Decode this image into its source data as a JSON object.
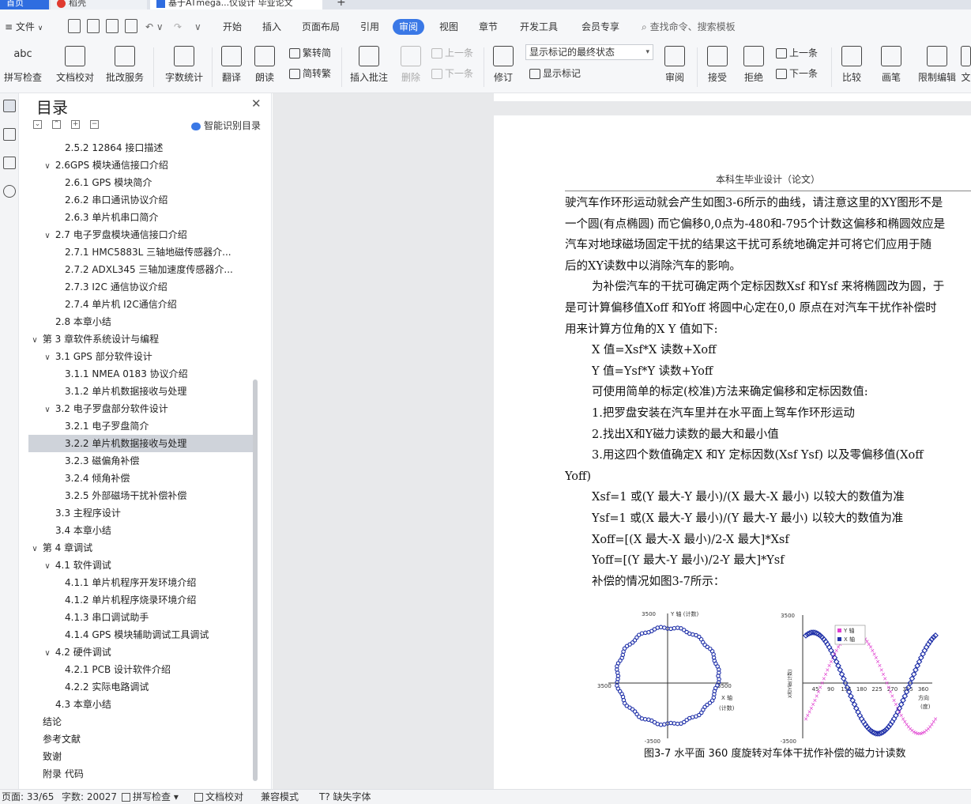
{
  "tabs": {
    "home": "首页",
    "find": "稻壳",
    "doc": "基于ATmega...仪设计 毕业论文",
    "new": "+"
  },
  "menu": {
    "file": "文件",
    "items": [
      "开始",
      "插入",
      "页面布局",
      "引用",
      "审阅",
      "视图",
      "章节",
      "开发工具",
      "会员专享"
    ],
    "active": "审阅",
    "search_placeholder": "查找命令、搜索模板"
  },
  "ribbon": {
    "spell_check": "拼写检查",
    "doc_proof": "文档校对",
    "batch_service": "批改服务",
    "word_count": "字数统计",
    "translate": "翻译",
    "read_aloud": "朗读",
    "trad_to_simp": "繁转简",
    "simp_to_trad": "简转繁",
    "insert_comment": "插入批注",
    "delete": "删除",
    "prev_item": "上一条",
    "next_item": "下一条",
    "revision": "修订",
    "markup_select": "显示标记的最终状态",
    "show_markup": "显示标记",
    "review": "审阅",
    "accept": "接受",
    "reject": "拒绝",
    "prev_change": "上一条",
    "next_change": "下一条",
    "compare": "比较",
    "pen": "画笔",
    "restrict_edit": "限制编辑",
    "more": "文"
  },
  "toc": {
    "title": "目录",
    "ai_toc": "智能识别目录",
    "items": [
      {
        "text": "2.5.2 12864 接口描述",
        "level": 3,
        "toggle": ""
      },
      {
        "text": "2.6GPS 模块通信接口介绍",
        "level": 2,
        "toggle": "∨"
      },
      {
        "text": "2.6.1 GPS 模块简介",
        "level": 3,
        "toggle": ""
      },
      {
        "text": "2.6.2 串口通讯协议介绍",
        "level": 3,
        "toggle": ""
      },
      {
        "text": "2.6.3 单片机串口简介",
        "level": 3,
        "toggle": ""
      },
      {
        "text": "2.7 电子罗盘模块通信接口介绍",
        "level": 2,
        "toggle": "∨"
      },
      {
        "text": "2.7.1 HMC5883L 三轴地磁传感器介...",
        "level": 3,
        "toggle": ""
      },
      {
        "text": "2.7.2 ADXL345 三轴加速度传感器介...",
        "level": 3,
        "toggle": ""
      },
      {
        "text": "2.7.3 I2C 通信协议介绍",
        "level": 3,
        "toggle": ""
      },
      {
        "text": "2.7.4 单片机 I2C通信介绍",
        "level": 3,
        "toggle": ""
      },
      {
        "text": "2.8 本章小结",
        "level": 2,
        "toggle": ""
      },
      {
        "text": "第 3 章软件系统设计与编程",
        "level": 1,
        "toggle": "∨"
      },
      {
        "text": "3.1 GPS 部分软件设计",
        "level": 2,
        "toggle": "∨"
      },
      {
        "text": "3.1.1 NMEA 0183 协议介绍",
        "level": 3,
        "toggle": ""
      },
      {
        "text": "3.1.2 单片机数据接收与处理",
        "level": 3,
        "toggle": ""
      },
      {
        "text": "3.2 电子罗盘部分软件设计",
        "level": 2,
        "toggle": "∨"
      },
      {
        "text": "3.2.1 电子罗盘简介",
        "level": 3,
        "toggle": ""
      },
      {
        "text": "3.2.2 单片机数据接收与处理",
        "level": 3,
        "toggle": "",
        "selected": true
      },
      {
        "text": "3.2.3 磁偏角补偿",
        "level": 3,
        "toggle": ""
      },
      {
        "text": "3.2.4 倾角补偿",
        "level": 3,
        "toggle": ""
      },
      {
        "text": "3.2.5 外部磁场干扰补偿补偿",
        "level": 3,
        "toggle": ""
      },
      {
        "text": "3.3 主程序设计",
        "level": 2,
        "toggle": ""
      },
      {
        "text": "3.4 本章小结",
        "level": 2,
        "toggle": ""
      },
      {
        "text": "第 4 章调试",
        "level": 1,
        "toggle": "∨"
      },
      {
        "text": "4.1 软件调试",
        "level": 2,
        "toggle": "∨"
      },
      {
        "text": "4.1.1 单片机程序开发环境介绍",
        "level": 3,
        "toggle": ""
      },
      {
        "text": "4.1.2 单片机程序烧录环境介绍",
        "level": 3,
        "toggle": ""
      },
      {
        "text": "4.1.3 串口调试助手",
        "level": 3,
        "toggle": ""
      },
      {
        "text": "4.1.4 GPS 模块辅助调试工具调试",
        "level": 3,
        "toggle": ""
      },
      {
        "text": "4.2 硬件调试",
        "level": 2,
        "toggle": "∨"
      },
      {
        "text": "4.2.1 PCB 设计软件介绍",
        "level": 3,
        "toggle": ""
      },
      {
        "text": "4.2.2 实际电路调试",
        "level": 3,
        "toggle": ""
      },
      {
        "text": "4.3 本章小结",
        "level": 2,
        "toggle": ""
      },
      {
        "text": "结论",
        "level": 1,
        "toggle": ""
      },
      {
        "text": "参考文献",
        "level": 1,
        "toggle": ""
      },
      {
        "text": "致谢",
        "level": 1,
        "toggle": ""
      },
      {
        "text": "附录 代码",
        "level": 1,
        "toggle": ""
      }
    ]
  },
  "document": {
    "header": "本科生毕业设计（论文）",
    "lines": [
      {
        "text": "驶汽车作环形运动就会产生如图3-6所示的曲线，请注意这里的XY图形不是",
        "indent": false
      },
      {
        "text": "一个圆(有点椭圆) 而它偏移0,0点为-480和-795个计数这偏移和椭圆效应是",
        "indent": false
      },
      {
        "text": "汽车对地球磁场固定干扰的结果这干扰可系统地确定并可将它们应用于随",
        "indent": false
      },
      {
        "text": "后的XY读数中以消除汽车的影响。",
        "indent": false
      },
      {
        "text": "为补偿汽车的干扰可确定两个定标因数Xsf 和Ysf 来将椭圆改为圆，于",
        "indent": true
      },
      {
        "text": "是可计算偏移值Xoff 和Yoff 将圆中心定在0,0 原点在对汽车干扰作补偿时",
        "indent": false
      },
      {
        "text": "用来计算方位角的X Y 值如下:",
        "indent": false
      },
      {
        "text": "X 值=Xsf*X 读数+Xoff",
        "indent": true
      },
      {
        "text": "Y 值=Ysf*Y 读数+Yoff",
        "indent": true
      },
      {
        "text": "可使用简单的标定(校准)方法来确定偏移和定标因数值:",
        "indent": true
      },
      {
        "text": "1.把罗盘安装在汽车里并在水平面上驾车作环形运动",
        "indent": true
      },
      {
        "text": "2.找出X和Y磁力读数的最大和最小值",
        "indent": true
      },
      {
        "text": "3.用这四个数值确定X 和Y 定标因数(Xsf Ysf) 以及零偏移值(Xoff",
        "indent": true
      },
      {
        "text": "Yoff)",
        "indent": false
      },
      {
        "text": "Xsf=1 或(Y 最大-Y 最小)/(X 最大-X 最小) 以较大的数值为准",
        "indent": true
      },
      {
        "text": "Ysf=1 或(X 最大-Y 最小)/(Y 最大-Y 最小) 以较大的数值为准",
        "indent": true
      },
      {
        "text": "Xoff=[(X 最大-X 最小)/2-X 最大]*Xsf",
        "indent": true
      },
      {
        "text": "Yoff=[(Y 最大-Y 最小)/2-Y 最大]*Ysf",
        "indent": true
      },
      {
        "text": "补偿的情况如图3-7所示：",
        "indent": true
      }
    ],
    "figure": {
      "left": {
        "ytop": "3500",
        "ybottom": "-3500",
        "xleft": "3500",
        "xright": "3500",
        "ylabel": "Y 轴 (计数)",
        "xlabel": "X 轴",
        "xunit": "(计数)"
      },
      "right": {
        "ytop": "3500",
        "ybottom": "-3500",
        "ylabel": "X和Y轴(计数)",
        "xticks": [
          "45",
          "90",
          "135",
          "180",
          "225",
          "270",
          "315",
          "360"
        ],
        "xlabel": "方向",
        "xunit": "(度)",
        "legend": [
          "Y 轴",
          "X 轴"
        ],
        "colors": {
          "y": "#e040d0",
          "x": "#1e2fa8"
        }
      },
      "caption": "图3-7 水平面 360 度旋转对车体干扰作补偿的磁力计读数"
    }
  },
  "status": {
    "page": "页面: 33/65",
    "words": "字数: 20027",
    "spell": "拼写检查",
    "proof": "文档校对",
    "compat": "兼容模式",
    "missing_font": "缺失字体"
  }
}
